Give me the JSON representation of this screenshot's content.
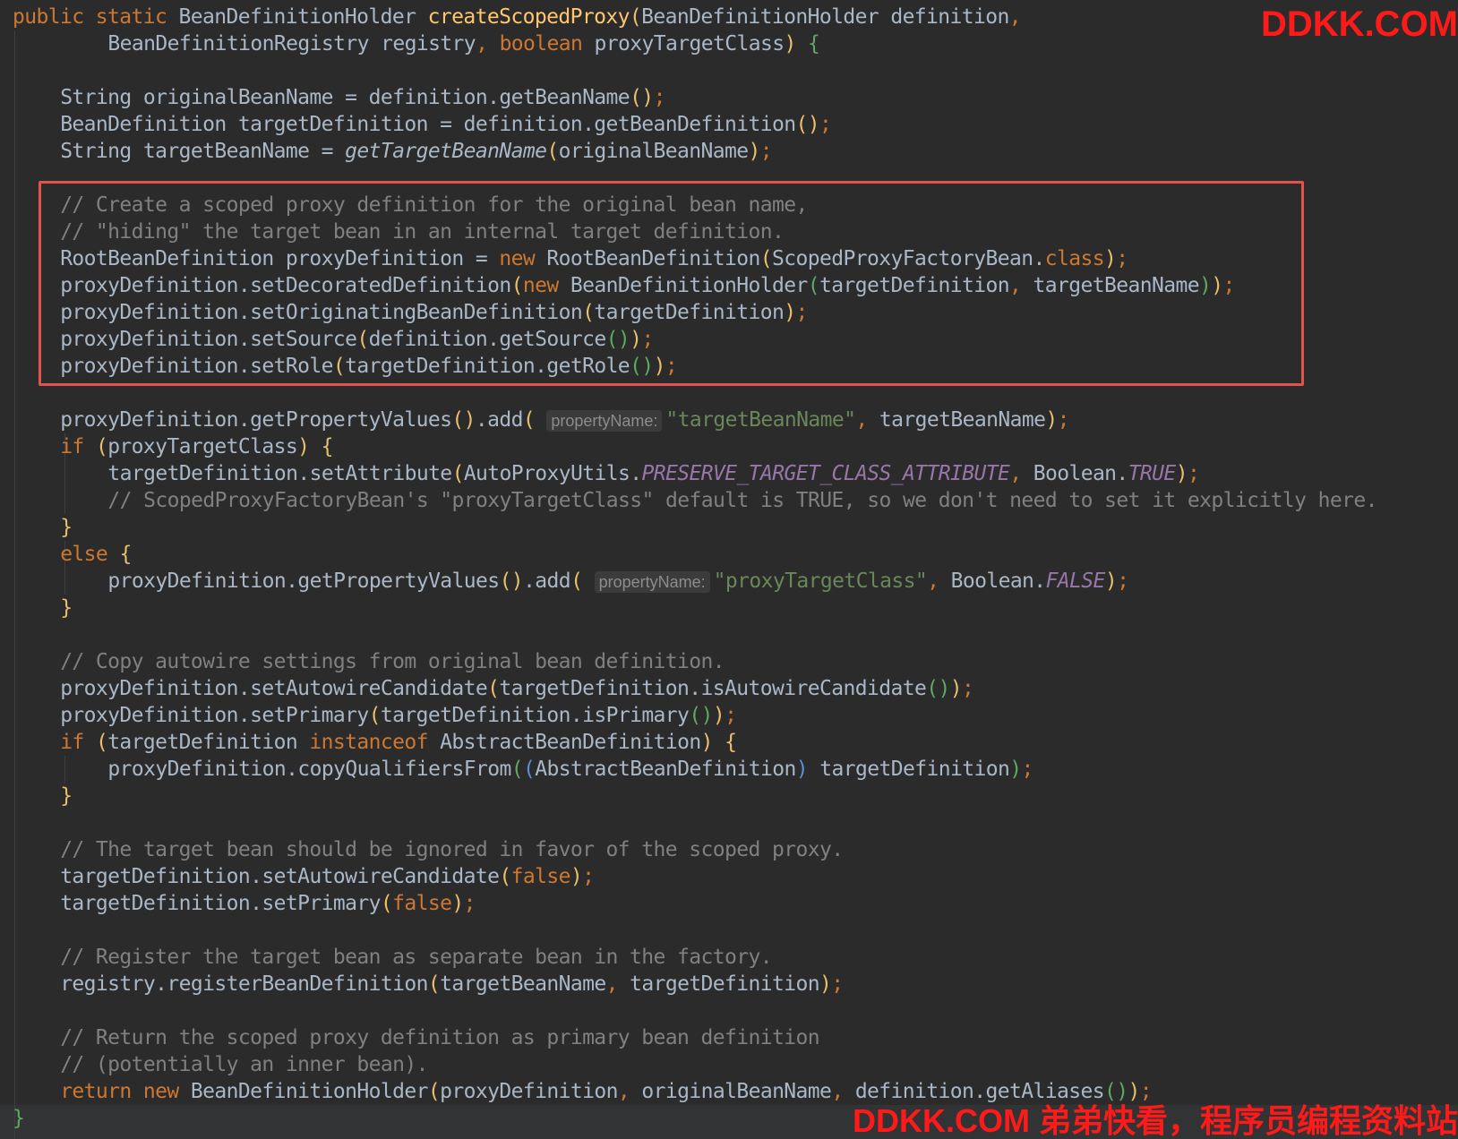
{
  "editor": {
    "language": "java",
    "theme_colors": {
      "background": "#2b2b2b",
      "text": "#a9b7c6",
      "keyword": "#cc7832",
      "method": "#ffc66d",
      "comment": "#808080",
      "string": "#6a8759",
      "constant": "#9876aa",
      "highlight_box": "#e3534d",
      "watermark": "#ff1a1a"
    },
    "lines": [
      {
        "indent": 0,
        "tokens": [
          {
            "t": "public static ",
            "c": "keyword"
          },
          {
            "t": "BeanDefinitionHolder ",
            "c": "plain"
          },
          {
            "t": "createScopedProxy",
            "c": "method"
          },
          {
            "t": "(",
            "c": "paren"
          },
          {
            "t": "BeanDefinitionHolder definition",
            "c": "plain"
          },
          {
            "t": ",",
            "c": "punct"
          }
        ]
      },
      {
        "indent": 8,
        "tokens": [
          {
            "t": "BeanDefinitionRegistry registry",
            "c": "plain"
          },
          {
            "t": ", ",
            "c": "punct"
          },
          {
            "t": "boolean ",
            "c": "keyword"
          },
          {
            "t": "proxyTargetClass",
            "c": "plain"
          },
          {
            "t": ") ",
            "c": "paren"
          },
          {
            "t": "{",
            "c": "paren2"
          }
        ]
      },
      {
        "indent": 0,
        "tokens": []
      },
      {
        "indent": 4,
        "tokens": [
          {
            "t": "String originalBeanName = definition.getBeanName",
            "c": "plain"
          },
          {
            "t": "()",
            "c": "paren"
          },
          {
            "t": ";",
            "c": "punct"
          }
        ]
      },
      {
        "indent": 4,
        "tokens": [
          {
            "t": "BeanDefinition targetDefinition = definition.getBeanDefinition",
            "c": "plain"
          },
          {
            "t": "()",
            "c": "paren"
          },
          {
            "t": ";",
            "c": "punct"
          }
        ]
      },
      {
        "indent": 4,
        "tokens": [
          {
            "t": "String targetBeanName = ",
            "c": "plain"
          },
          {
            "t": "getTargetBeanName",
            "c": "italic"
          },
          {
            "t": "(",
            "c": "paren"
          },
          {
            "t": "originalBeanName",
            "c": "plain"
          },
          {
            "t": ")",
            "c": "paren"
          },
          {
            "t": ";",
            "c": "punct"
          }
        ]
      },
      {
        "indent": 0,
        "tokens": []
      },
      {
        "indent": 4,
        "tokens": [
          {
            "t": "// Create a scoped proxy definition for the original bean name,",
            "c": "comment"
          }
        ]
      },
      {
        "indent": 4,
        "tokens": [
          {
            "t": "// \"hiding\" the target bean in an internal target definition.",
            "c": "comment"
          }
        ]
      },
      {
        "indent": 4,
        "tokens": [
          {
            "t": "RootBeanDefinition proxyDefinition = ",
            "c": "plain"
          },
          {
            "t": "new ",
            "c": "keyword"
          },
          {
            "t": "RootBeanDefinition",
            "c": "plain"
          },
          {
            "t": "(",
            "c": "paren"
          },
          {
            "t": "ScopedProxyFactoryBean.",
            "c": "plain"
          },
          {
            "t": "class",
            "c": "keyword"
          },
          {
            "t": ")",
            "c": "paren"
          },
          {
            "t": ";",
            "c": "punct"
          }
        ]
      },
      {
        "indent": 4,
        "tokens": [
          {
            "t": "proxyDefinition.setDecoratedDefinition",
            "c": "plain"
          },
          {
            "t": "(",
            "c": "paren"
          },
          {
            "t": "new ",
            "c": "keyword"
          },
          {
            "t": "BeanDefinitionHolder",
            "c": "plain"
          },
          {
            "t": "(",
            "c": "paren2"
          },
          {
            "t": "targetDefinition",
            "c": "plain"
          },
          {
            "t": ", ",
            "c": "punct"
          },
          {
            "t": "targetBeanName",
            "c": "plain"
          },
          {
            "t": ")",
            "c": "paren2"
          },
          {
            "t": ")",
            "c": "paren"
          },
          {
            "t": ";",
            "c": "punct"
          }
        ]
      },
      {
        "indent": 4,
        "tokens": [
          {
            "t": "proxyDefinition.setOriginatingBeanDefinition",
            "c": "plain"
          },
          {
            "t": "(",
            "c": "paren"
          },
          {
            "t": "targetDefinition",
            "c": "plain"
          },
          {
            "t": ")",
            "c": "paren"
          },
          {
            "t": ";",
            "c": "punct"
          }
        ]
      },
      {
        "indent": 4,
        "tokens": [
          {
            "t": "proxyDefinition.setSource",
            "c": "plain"
          },
          {
            "t": "(",
            "c": "paren"
          },
          {
            "t": "definition.getSource",
            "c": "plain"
          },
          {
            "t": "()",
            "c": "paren2"
          },
          {
            "t": ")",
            "c": "paren"
          },
          {
            "t": ";",
            "c": "punct"
          }
        ]
      },
      {
        "indent": 4,
        "tokens": [
          {
            "t": "proxyDefinition.setRole",
            "c": "plain"
          },
          {
            "t": "(",
            "c": "paren"
          },
          {
            "t": "targetDefinition.getRole",
            "c": "plain"
          },
          {
            "t": "()",
            "c": "paren2"
          },
          {
            "t": ")",
            "c": "paren"
          },
          {
            "t": ";",
            "c": "punct"
          }
        ]
      },
      {
        "indent": 0,
        "tokens": []
      },
      {
        "indent": 4,
        "tokens": [
          {
            "t": "proxyDefinition.getPropertyValues",
            "c": "plain"
          },
          {
            "t": "()",
            "c": "paren"
          },
          {
            "t": ".add",
            "c": "plain"
          },
          {
            "t": "( ",
            "c": "paren"
          },
          {
            "t": "propertyName:",
            "c": "hint"
          },
          {
            "t": "\"targetBeanName\"",
            "c": "string"
          },
          {
            "t": ", ",
            "c": "punct"
          },
          {
            "t": "targetBeanName",
            "c": "plain"
          },
          {
            "t": ")",
            "c": "paren"
          },
          {
            "t": ";",
            "c": "punct"
          }
        ]
      },
      {
        "indent": 4,
        "tokens": [
          {
            "t": "if ",
            "c": "keyword"
          },
          {
            "t": "(",
            "c": "paren"
          },
          {
            "t": "proxyTargetClass",
            "c": "plain"
          },
          {
            "t": ") ",
            "c": "paren"
          },
          {
            "t": "{",
            "c": "paren"
          }
        ]
      },
      {
        "indent": 8,
        "tokens": [
          {
            "t": "targetDefinition.setAttribute",
            "c": "plain"
          },
          {
            "t": "(",
            "c": "paren"
          },
          {
            "t": "AutoProxyUtils.",
            "c": "plain"
          },
          {
            "t": "PRESERVE_TARGET_CLASS_ATTRIBUTE",
            "c": "const"
          },
          {
            "t": ", ",
            "c": "punct"
          },
          {
            "t": "Boolean.",
            "c": "plain"
          },
          {
            "t": "TRUE",
            "c": "const"
          },
          {
            "t": ")",
            "c": "paren"
          },
          {
            "t": ";",
            "c": "punct"
          }
        ]
      },
      {
        "indent": 8,
        "tokens": [
          {
            "t": "// ScopedProxyFactoryBean's \"proxyTargetClass\" default is TRUE, so we don't need to set it explicitly here.",
            "c": "comment"
          }
        ]
      },
      {
        "indent": 4,
        "tokens": [
          {
            "t": "}",
            "c": "paren"
          }
        ]
      },
      {
        "indent": 4,
        "tokens": [
          {
            "t": "else ",
            "c": "keyword"
          },
          {
            "t": "{",
            "c": "paren"
          }
        ]
      },
      {
        "indent": 8,
        "tokens": [
          {
            "t": "proxyDefinition.getPropertyValues",
            "c": "plain"
          },
          {
            "t": "()",
            "c": "paren"
          },
          {
            "t": ".add",
            "c": "plain"
          },
          {
            "t": "( ",
            "c": "paren"
          },
          {
            "t": "propertyName:",
            "c": "hint"
          },
          {
            "t": "\"proxyTargetClass\"",
            "c": "string"
          },
          {
            "t": ", ",
            "c": "punct"
          },
          {
            "t": "Boolean.",
            "c": "plain"
          },
          {
            "t": "FALSE",
            "c": "const"
          },
          {
            "t": ")",
            "c": "paren"
          },
          {
            "t": ";",
            "c": "punct"
          }
        ]
      },
      {
        "indent": 4,
        "tokens": [
          {
            "t": "}",
            "c": "paren"
          }
        ]
      },
      {
        "indent": 0,
        "tokens": []
      },
      {
        "indent": 4,
        "tokens": [
          {
            "t": "// Copy autowire settings from original bean definition.",
            "c": "comment"
          }
        ]
      },
      {
        "indent": 4,
        "tokens": [
          {
            "t": "proxyDefinition.setAutowireCandidate",
            "c": "plain"
          },
          {
            "t": "(",
            "c": "paren"
          },
          {
            "t": "targetDefinition.isAutowireCandidate",
            "c": "plain"
          },
          {
            "t": "()",
            "c": "paren2"
          },
          {
            "t": ")",
            "c": "paren"
          },
          {
            "t": ";",
            "c": "punct"
          }
        ]
      },
      {
        "indent": 4,
        "tokens": [
          {
            "t": "proxyDefinition.setPrimary",
            "c": "plain"
          },
          {
            "t": "(",
            "c": "paren"
          },
          {
            "t": "targetDefinition.isPrimary",
            "c": "plain"
          },
          {
            "t": "()",
            "c": "paren2"
          },
          {
            "t": ")",
            "c": "paren"
          },
          {
            "t": ";",
            "c": "punct"
          }
        ]
      },
      {
        "indent": 4,
        "tokens": [
          {
            "t": "if ",
            "c": "keyword"
          },
          {
            "t": "(",
            "c": "paren"
          },
          {
            "t": "targetDefinition ",
            "c": "plain"
          },
          {
            "t": "instanceof ",
            "c": "keyword"
          },
          {
            "t": "AbstractBeanDefinition",
            "c": "plain"
          },
          {
            "t": ") ",
            "c": "paren"
          },
          {
            "t": "{",
            "c": "paren"
          }
        ]
      },
      {
        "indent": 8,
        "tokens": [
          {
            "t": "proxyDefinition.copyQualifiersFrom",
            "c": "plain"
          },
          {
            "t": "(",
            "c": "paren2"
          },
          {
            "t": "(",
            "c": "paren3"
          },
          {
            "t": "AbstractBeanDefinition",
            "c": "plain"
          },
          {
            "t": ") ",
            "c": "paren3"
          },
          {
            "t": "targetDefinition",
            "c": "plain"
          },
          {
            "t": ")",
            "c": "paren2"
          },
          {
            "t": ";",
            "c": "punct"
          }
        ]
      },
      {
        "indent": 4,
        "tokens": [
          {
            "t": "}",
            "c": "paren"
          }
        ]
      },
      {
        "indent": 0,
        "tokens": []
      },
      {
        "indent": 4,
        "tokens": [
          {
            "t": "// The target bean should be ignored in favor of the scoped proxy.",
            "c": "comment"
          }
        ]
      },
      {
        "indent": 4,
        "tokens": [
          {
            "t": "targetDefinition.setAutowireCandidate",
            "c": "plain"
          },
          {
            "t": "(",
            "c": "paren"
          },
          {
            "t": "false",
            "c": "keyword"
          },
          {
            "t": ")",
            "c": "paren"
          },
          {
            "t": ";",
            "c": "punct"
          }
        ]
      },
      {
        "indent": 4,
        "tokens": [
          {
            "t": "targetDefinition.setPrimary",
            "c": "plain"
          },
          {
            "t": "(",
            "c": "paren"
          },
          {
            "t": "false",
            "c": "keyword"
          },
          {
            "t": ")",
            "c": "paren"
          },
          {
            "t": ";",
            "c": "punct"
          }
        ]
      },
      {
        "indent": 0,
        "tokens": []
      },
      {
        "indent": 4,
        "tokens": [
          {
            "t": "// Register the target bean as separate bean in the factory.",
            "c": "comment"
          }
        ]
      },
      {
        "indent": 4,
        "tokens": [
          {
            "t": "registry.registerBeanDefinition",
            "c": "plain"
          },
          {
            "t": "(",
            "c": "paren"
          },
          {
            "t": "targetBeanName",
            "c": "plain"
          },
          {
            "t": ", ",
            "c": "punct"
          },
          {
            "t": "targetDefinition",
            "c": "plain"
          },
          {
            "t": ")",
            "c": "paren"
          },
          {
            "t": ";",
            "c": "punct"
          }
        ]
      },
      {
        "indent": 0,
        "tokens": []
      },
      {
        "indent": 4,
        "tokens": [
          {
            "t": "// Return the scoped proxy definition as primary bean definition",
            "c": "comment"
          }
        ]
      },
      {
        "indent": 4,
        "tokens": [
          {
            "t": "// (potentially an inner bean).",
            "c": "comment"
          }
        ]
      },
      {
        "indent": 4,
        "tokens": [
          {
            "t": "return new ",
            "c": "keyword"
          },
          {
            "t": "BeanDefinitionHolder",
            "c": "plain"
          },
          {
            "t": "(",
            "c": "paren"
          },
          {
            "t": "proxyDefinition",
            "c": "plain"
          },
          {
            "t": ", ",
            "c": "punct"
          },
          {
            "t": "originalBeanName",
            "c": "plain"
          },
          {
            "t": ", ",
            "c": "punct"
          },
          {
            "t": "definition.getAliases",
            "c": "plain"
          },
          {
            "t": "()",
            "c": "paren2"
          },
          {
            "t": ")",
            "c": "paren"
          },
          {
            "t": ";",
            "c": "punct"
          }
        ]
      },
      {
        "indent": 0,
        "tokens": [
          {
            "t": "}",
            "c": "paren2"
          }
        ]
      }
    ]
  },
  "watermarks": {
    "top": "DDKK.COM",
    "bottom": "DDKK.COM 弟弟快看，程序员编程资料站"
  }
}
